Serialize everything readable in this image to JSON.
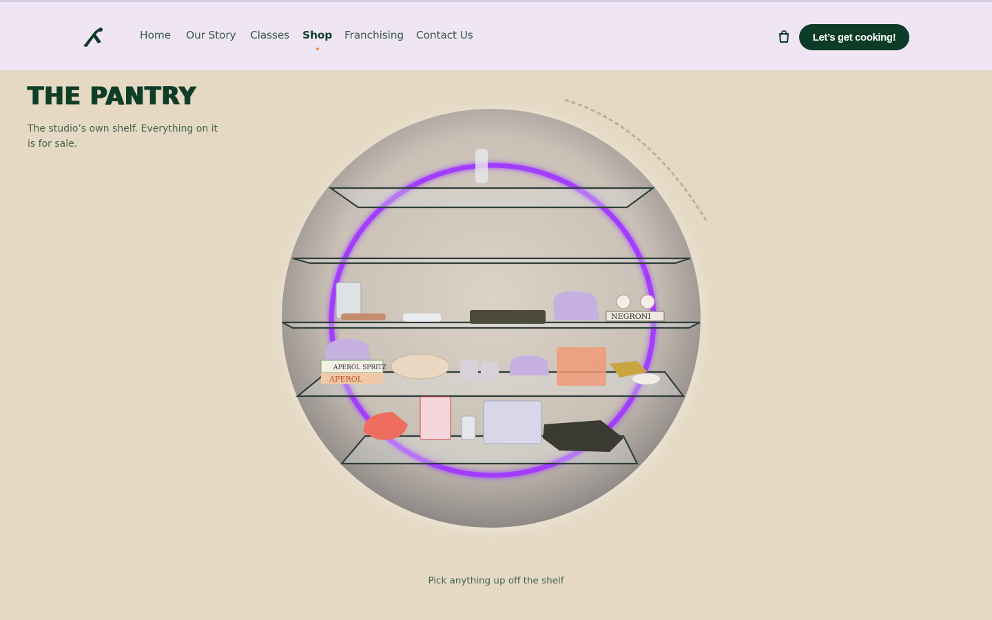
{
  "nav": {
    "items": [
      {
        "label": "Home",
        "active": false
      },
      {
        "label": "Our Story",
        "active": false
      },
      {
        "label": "Classes",
        "active": false
      },
      {
        "label": "Shop",
        "active": true
      },
      {
        "label": "Franchising",
        "active": false
      },
      {
        "label": "Contact Us",
        "active": false
      }
    ],
    "cta_label": "Let’s get cooking!",
    "cart_icon": "shopping-bag-icon",
    "logo_icon": "brand-logo-icon"
  },
  "hero": {
    "title": "THE PANTRY",
    "subtitle": "The studio’s own shelf. Everything on it is for sale.",
    "caption": "Pick anything up off the shelf"
  },
  "shelf_labels": {
    "book_top": "NEGRONI",
    "book_bottom_1": "APEROL SPRITZ",
    "book_bottom_2": "APEROL"
  },
  "colors": {
    "brand_green": "#0c3b27",
    "accent_orange": "#f08a2c",
    "header_bg": "#efe5f4",
    "page_bg": "#e5d9c4",
    "neon_ring": "#a23cff"
  }
}
